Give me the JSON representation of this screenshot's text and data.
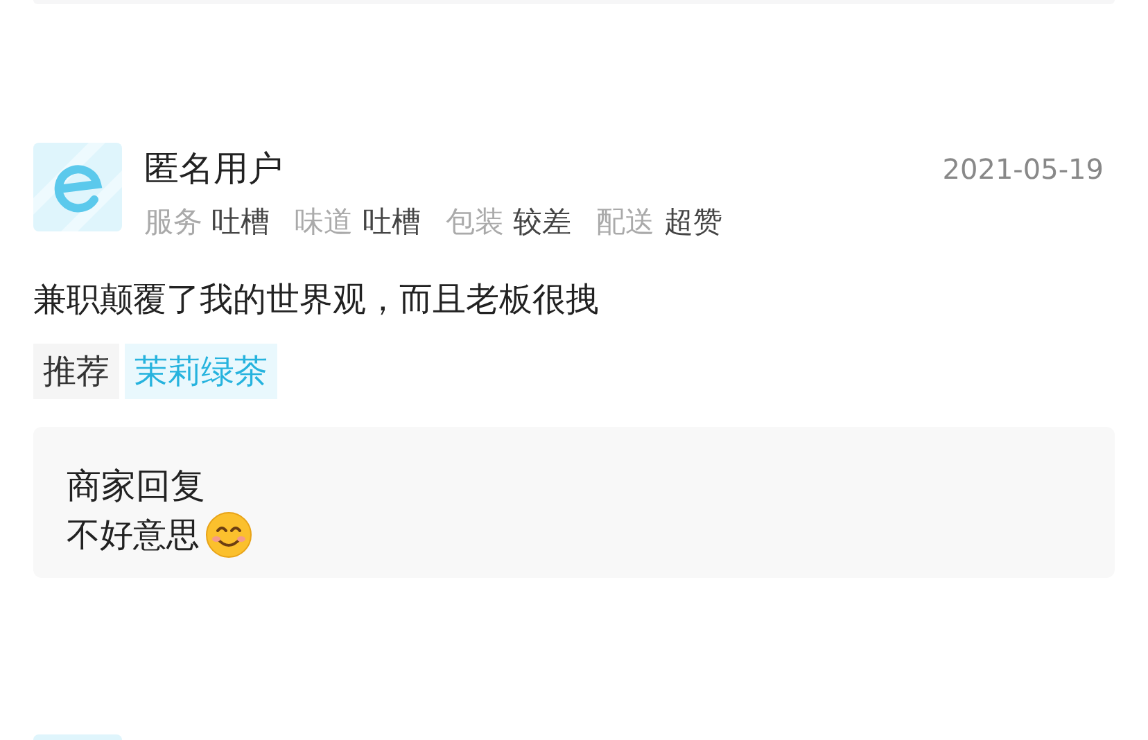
{
  "review": {
    "user": "匿名用户",
    "date": "2021-05-19",
    "ratings": [
      {
        "label": "服务",
        "value": "吐槽"
      },
      {
        "label": "味道",
        "value": "吐槽"
      },
      {
        "label": "包装",
        "value": "较差"
      },
      {
        "label": "配送",
        "value": "超赞"
      }
    ],
    "text": "兼职颠覆了我的世界观，而且老板很拽",
    "tags": [
      {
        "kind": "label",
        "text": "推荐"
      },
      {
        "kind": "dish",
        "text": "茉莉绿茶"
      }
    ],
    "reply": {
      "title": "商家回复",
      "text": "不好意思"
    }
  }
}
